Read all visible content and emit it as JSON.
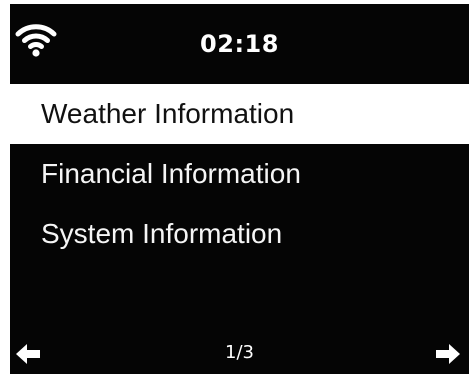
{
  "status": {
    "time": "02:18",
    "wifi_icon": "wifi-icon"
  },
  "menu": {
    "items": [
      {
        "label": "Weather Information",
        "selected": true
      },
      {
        "label": "Financial Information",
        "selected": false
      },
      {
        "label": "System Information",
        "selected": false
      }
    ]
  },
  "footer": {
    "page": "1/3",
    "prev_icon": "arrow-left-icon",
    "next_icon": "arrow-right-icon"
  },
  "colors": {
    "background": "#050505",
    "highlight": "#ffffff",
    "text": "#ffffff"
  }
}
